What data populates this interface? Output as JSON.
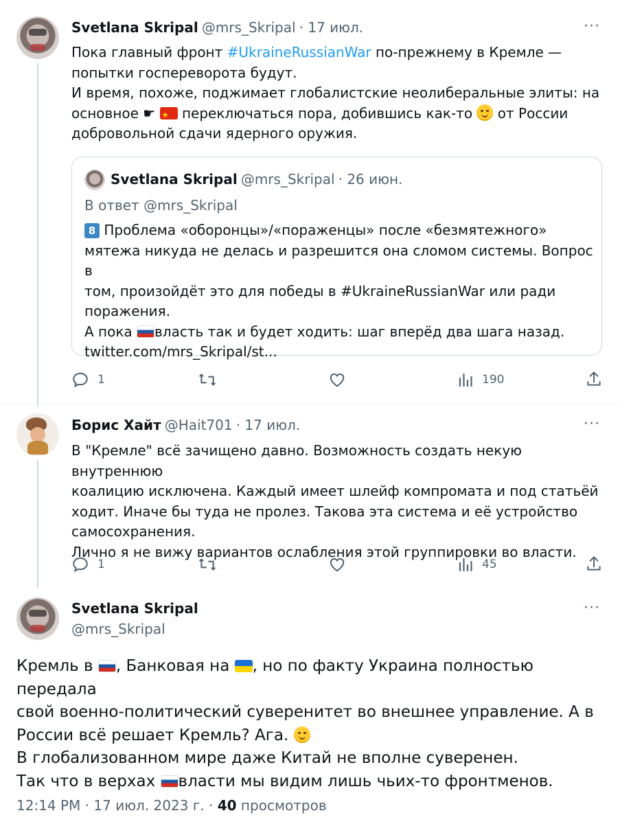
{
  "tweet1": {
    "name": "Svetlana Skripal",
    "handle": "@mrs_Skripal",
    "date": "· 17 июл.",
    "line1_pre": "Пока главный фронт ",
    "line1_tag": "#UkraineRussianWar",
    "line1_post": " по-прежнему в Кремле —",
    "line2": "попытки госпереворота будут.",
    "line3": "И время, похоже, поджимает глобалистские неолиберальные элиты: на",
    "line4_pre": "основное ☛",
    "line4_post": " переключаться пора, добившись как-то",
    "line4_end": " от России",
    "line5": "добровольной сдачи ядерного оружия.",
    "more_label": "···",
    "reply_count": "1",
    "views_count": "190"
  },
  "quote": {
    "name": "Svetlana Skripal",
    "handle": "@mrs_Skripal",
    "date": "· 26 июн.",
    "reply_to": "В ответ @mrs_Skripal",
    "badge": "8",
    "line1": " Проблема «оборонцы»/«пораженцы» после «безмятежного»",
    "line2": "мятежа никуда не делась и разрешится она сломом системы. Вопрос в",
    "line3": "том, произойдёт это для победы в #UkraineRussianWar или ради",
    "line4": "поражения.",
    "line5_pre": "А пока ",
    "line5_post": "власть так и будет ходить: шаг вперёд два шага назад.",
    "line6": "twitter.com/mrs_Skripal/st..."
  },
  "tweet2": {
    "name": "Борис Хайт",
    "handle": "@Hait701",
    "date": "· 17 июл.",
    "line1": "В \"Кремле\" всё зачищено давно. Возможность создать некую внутреннюю",
    "line2": "коалицию исключена. Каждый имеет шлейф компромата и под статьёй",
    "line3": "ходит. Иначе бы туда не пролез. Такова эта система и её устройство",
    "line4": "самосохранения.",
    "line5": "Лично я не вижу вариантов ослабления этой группировки во власти.",
    "more_label": "···",
    "reply_count": "1",
    "views_count": "45"
  },
  "main": {
    "name": "Svetlana Skripal",
    "handle": "@mrs_Skripal",
    "more_label": "···",
    "line1_pre": "Кремль в ",
    "line1_mid": ", Банковая на ",
    "line1_post": ", но по факту Украина полностью передала",
    "line2": "свой военно-политический суверенитет во внешнее управление. А в",
    "line3": "России всё решает Кремль? Ага.",
    "line4": "В глобализованном мире даже Китай не вполне суверенен.",
    "line5_pre": "Так что в верхах ",
    "line5_post": "власти мы видим лишь чьих-то фронтменов.",
    "time": "12:14 PM",
    "sep1": " · ",
    "date": "17 июл. 2023 г.",
    "sep2": " · ",
    "views_num": "40",
    "views_label": " просмотров"
  },
  "icons": {
    "reply": "reply-icon",
    "retweet": "retweet-icon",
    "like": "heart-icon",
    "views": "views-icon",
    "share": "share-icon",
    "more": "more-icon"
  }
}
